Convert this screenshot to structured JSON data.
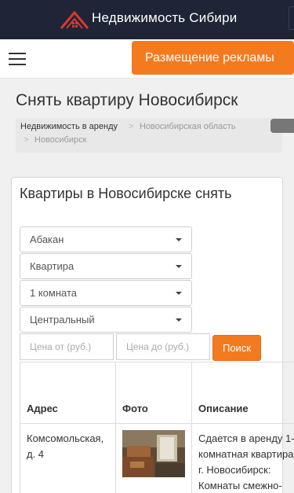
{
  "header": {
    "site_title": "Недвижимость Сибири",
    "brand_color": "#1f2536",
    "logo_icon": "house-roof-icon"
  },
  "navbar": {
    "menu_icon": "hamburger-menu-icon",
    "ad_button_label": "Размещение рекламы",
    "accent_color": "#f47a20"
  },
  "page": {
    "title": "Снять квартиру Новосибирск"
  },
  "breadcrumb": {
    "items": [
      "Недвижимость в аренду",
      "Новосибирская область",
      "Новосибирск"
    ],
    "separator": ">"
  },
  "filters": {
    "heading": "Квартиры в Новосибирске снять",
    "city": "Абакан",
    "type": "Квартира",
    "rooms": "1 комната",
    "district": "Центральный",
    "price_from_placeholder": "Цена от (руб.)",
    "price_to_placeholder": "Цена до (руб.)",
    "search_label": "Поиск"
  },
  "table": {
    "columns": [
      "Адрес",
      "Фото",
      "Описание"
    ],
    "rows": [
      {
        "address": "Комсомольская, д. 4",
        "description": "Сдается в аренду 1-комнатная квартира - г. Новосибирск: Комнаты смежно-"
      }
    ]
  }
}
